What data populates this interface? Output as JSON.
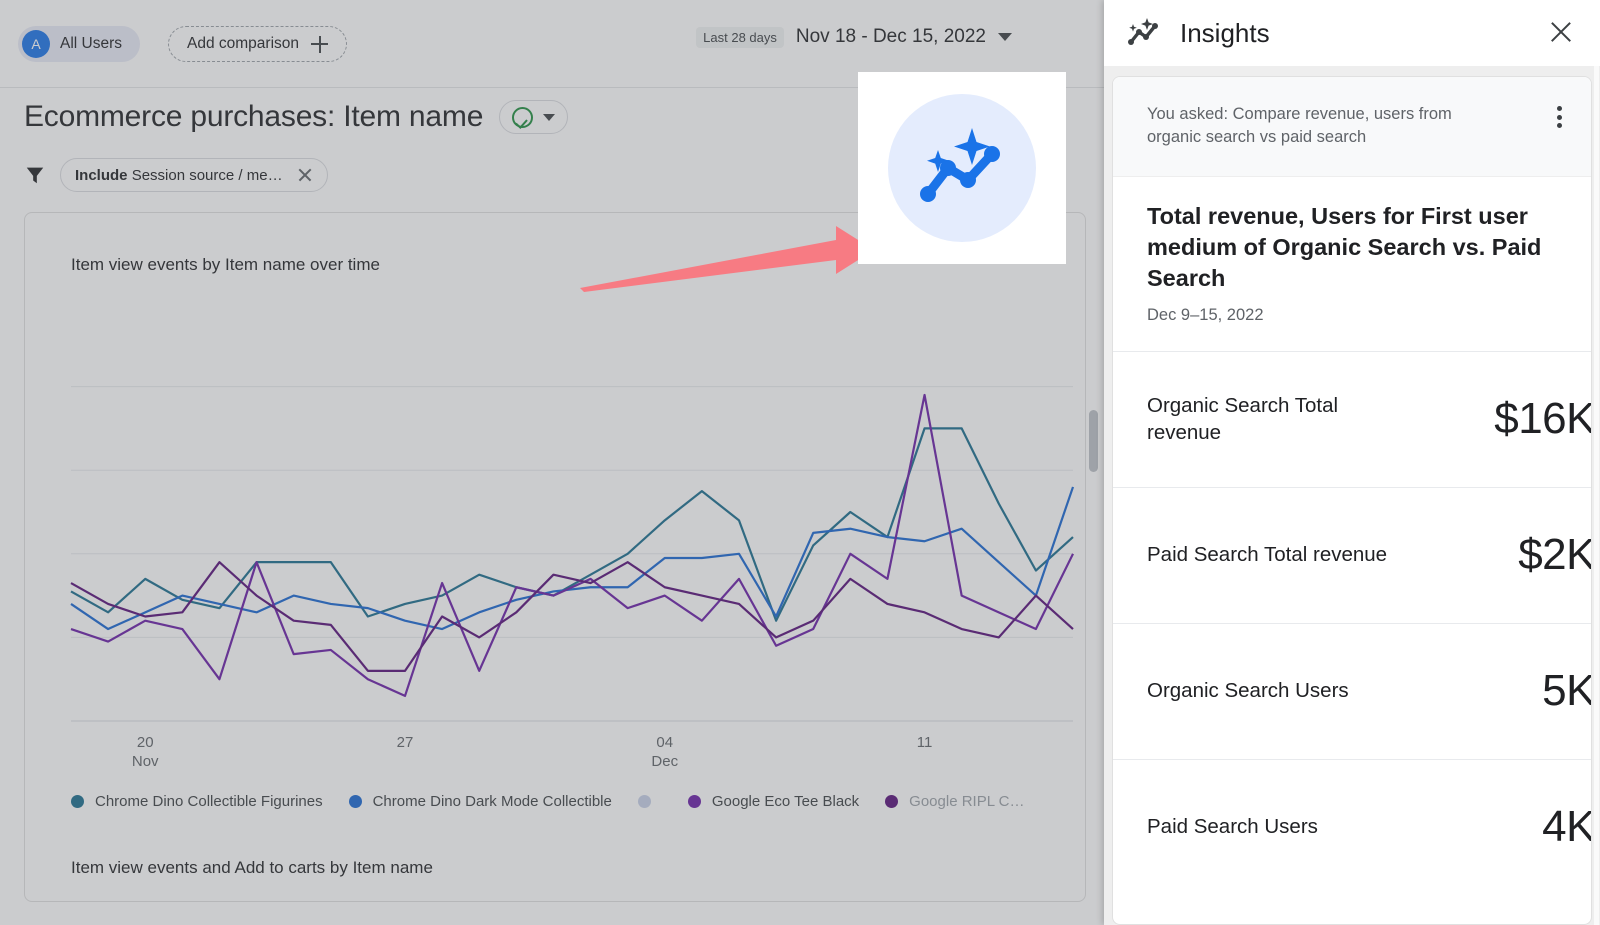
{
  "topbar": {
    "audience": {
      "avatar_letter": "A",
      "label": "All Users"
    },
    "add_comparison_label": "Add comparison",
    "date_range": {
      "chip": "Last 28 days",
      "range": "Nov 18 - Dec 15, 2022"
    }
  },
  "page": {
    "title": "Ecommerce purchases: Item name",
    "filter": {
      "prefix": "Include",
      "text": "Session source / me…"
    }
  },
  "card": {
    "chart_title": "Item view events by Item name over time",
    "second_chart_title": "Item view events and Add to carts by Item name"
  },
  "insights": {
    "panel_title": "Insights",
    "asked_text": "You asked: Compare revenue, users from organic search vs paid search",
    "insight_title": "Total revenue, Users for First user medium of Organic Search vs. Paid Search",
    "insight_subtitle": "Dec 9–15, 2022",
    "metrics": [
      {
        "label": "Organic Search Total revenue",
        "value": "$16K"
      },
      {
        "label": "Paid Search Total revenue",
        "value": "$2K"
      },
      {
        "label": "Organic Search Users",
        "value": "5K"
      },
      {
        "label": "Paid Search Users",
        "value": "4K"
      }
    ]
  },
  "colors": {
    "brand_blue": "#1a73e8",
    "series_teal": "#1a6e8e",
    "series_blue": "#1967d2",
    "series_gray": "#c6d0e8",
    "series_purple": "#6a1fa8",
    "series_darkpurple": "#57107a",
    "green_check": "#1e8e3e",
    "arrow_pink": "#f77b83"
  },
  "chart_data": {
    "type": "line",
    "title": "Item view events by Item name over time",
    "xlabel": "",
    "ylabel": "",
    "grid": true,
    "legend_position": "bottom",
    "x_tick_labels": [
      "20\nNov",
      "27",
      "04\nDec",
      "11"
    ],
    "x_tick_positions": [
      2,
      9,
      16,
      23
    ],
    "x": [
      0,
      1,
      2,
      3,
      4,
      5,
      6,
      7,
      8,
      9,
      10,
      11,
      12,
      13,
      14,
      15,
      16,
      17,
      18,
      19,
      20,
      21,
      22,
      23,
      24,
      25,
      26,
      27
    ],
    "ylim": [
      0,
      100
    ],
    "series": [
      {
        "name": "Chrome Dino Collectible Figurines",
        "color": "#1a6e8e",
        "values": [
          31,
          26,
          34,
          29,
          27,
          38,
          38,
          38,
          25,
          28,
          30,
          35,
          32,
          30,
          35,
          40,
          48,
          55,
          48,
          24,
          42,
          50,
          44,
          70,
          70,
          52,
          36,
          44
        ]
      },
      {
        "name": "Chrome Dino Dark Mode Collectible",
        "color": "#1967d2",
        "values": [
          28,
          22,
          26,
          30,
          28,
          26,
          30,
          28,
          27,
          24,
          22,
          26,
          29,
          31,
          32,
          32,
          39,
          39,
          40,
          25,
          45,
          46,
          44,
          43,
          46,
          38,
          30,
          56
        ]
      },
      {
        "name": "",
        "color": "#c6d0e8",
        "values": []
      },
      {
        "name": "Google Eco Tee Black",
        "color": "#6a1fa8",
        "values": [
          22,
          19,
          24,
          22,
          10,
          38,
          16,
          17,
          10,
          6,
          33,
          12,
          32,
          30,
          34,
          27,
          30,
          24,
          34,
          18,
          22,
          40,
          34,
          78,
          30,
          26,
          22,
          40
        ]
      },
      {
        "name": "Google RIPL C…",
        "color": "#57107a",
        "values": [
          33,
          28,
          25,
          26,
          38,
          30,
          24,
          23,
          12,
          12,
          25,
          20,
          26,
          35,
          33,
          38,
          32,
          30,
          28,
          20,
          24,
          34,
          28,
          26,
          22,
          20,
          30,
          22
        ]
      }
    ]
  }
}
